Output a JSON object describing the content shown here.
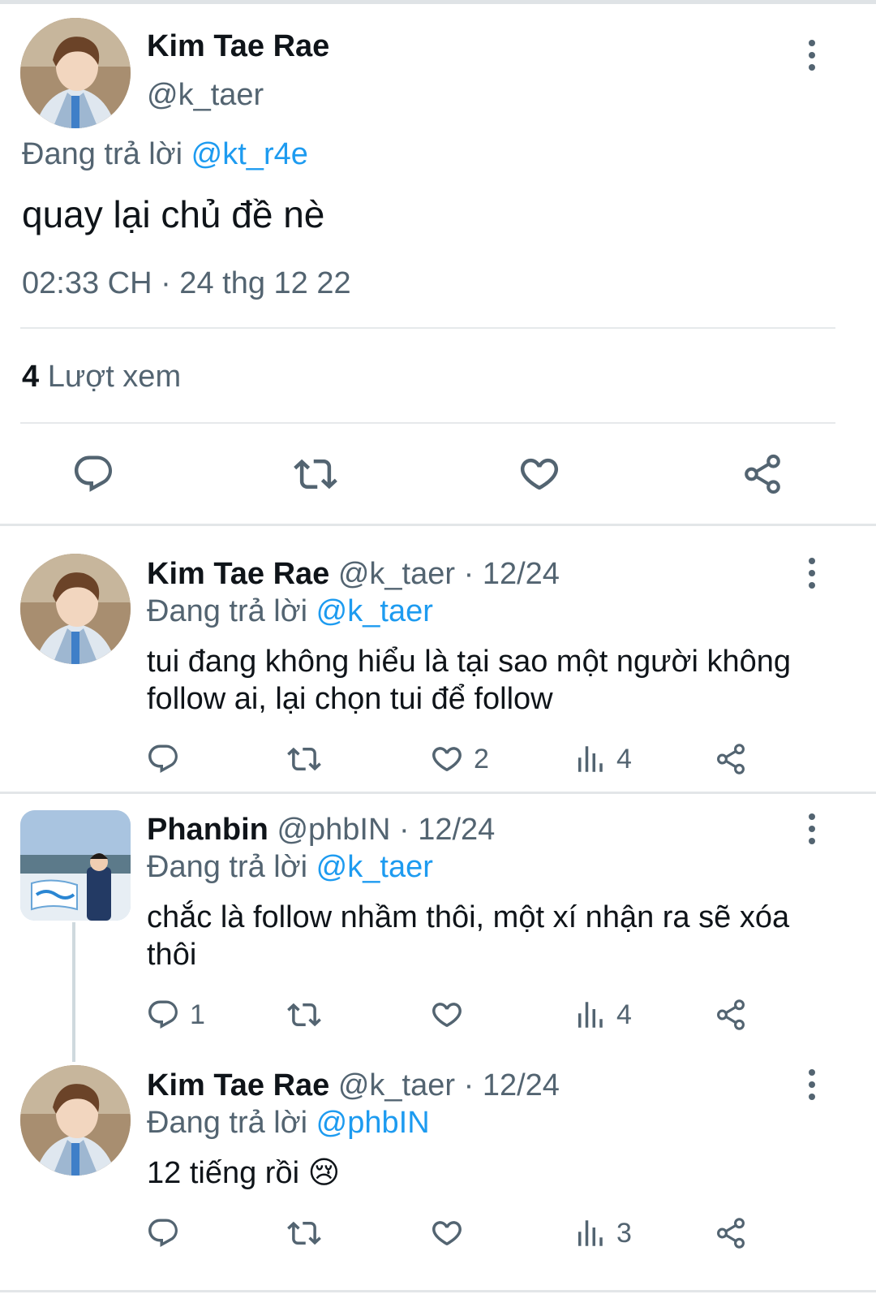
{
  "main_tweet": {
    "name": "Kim Tae Rae",
    "handle": "@k_taer",
    "replying_prefix": "Đang trả lời",
    "replying_to": "@kt_r4e",
    "text": "quay lại chủ đề nè",
    "timestamp": "02:33 CH · 24 thg 12 22",
    "views_count": "4",
    "views_label": "Lượt xem"
  },
  "replies": [
    {
      "name": "Kim Tae Rae",
      "handle": "@k_taer",
      "date": "· 12/24",
      "replying_prefix": "Đang trả lời",
      "replying_to": "@k_taer",
      "text_line1": "tui đang không hiểu là tại sao một người không",
      "text_line2": "follow ai, lại chọn tui để follow",
      "reply_count": "",
      "like_count": "2",
      "view_count": "4"
    },
    {
      "name": "Phanbin",
      "handle": "@phbIN",
      "date": "· 12/24",
      "replying_prefix": "Đang trả lời",
      "replying_to": "@k_taer",
      "text_line1": "chắc là follow nhầm thôi, một xí nhận ra sẽ xóa",
      "text_line2": "thôi",
      "reply_count": "1",
      "like_count": "",
      "view_count": "4"
    },
    {
      "name": "Kim Tae Rae",
      "handle": "@k_taer",
      "date": "· 12/24",
      "replying_prefix": "Đang trả lời",
      "replying_to": "@phbIN",
      "text_line1": "12 tiếng rồi 😢",
      "reply_count": "",
      "like_count": "",
      "view_count": "3"
    }
  ],
  "icons": {
    "reply": "reply-icon",
    "retweet": "retweet-icon",
    "like": "heart-icon",
    "views": "views-icon",
    "share": "share-icon",
    "more": "more-vertical-icon"
  },
  "colors": {
    "link": "#1d9bf0",
    "muted": "#536471",
    "text": "#0f1419"
  }
}
